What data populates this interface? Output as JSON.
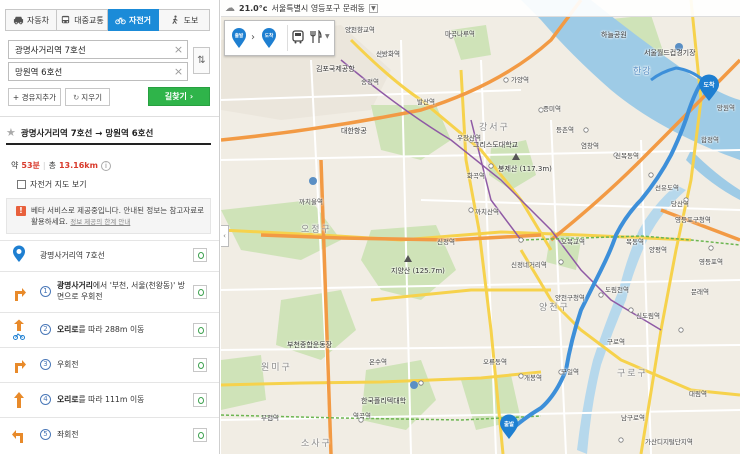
{
  "tabs": [
    {
      "label": "자동차",
      "icon": "car-icon",
      "active": false
    },
    {
      "label": "대중교통",
      "icon": "bus-icon",
      "active": false
    },
    {
      "label": "자전거",
      "icon": "bicycle-icon",
      "active": true
    },
    {
      "label": "도보",
      "icon": "walk-icon",
      "active": false
    }
  ],
  "search": {
    "origin_value": "광명사거리역 7호선",
    "destination_value": "망원역 6호선"
  },
  "actions": {
    "add_waypoint": "+ 경유지추가",
    "clear": "지우기",
    "find_route": "길찾기"
  },
  "route": {
    "title": "광명사거리역 7호선 → 망원역 6호선",
    "time_prefix": "약",
    "time": "53분",
    "distance_prefix": "총",
    "distance": "13.16km",
    "bike_map_label": "자전거 지도 보기",
    "beta_notice": "베타 서비스로 제공중입니다. 안내된 정보는 참고자료로 활용하세요.",
    "beta_link": "정보 제공의 한계 안내",
    "start_label": "광명사거리역 7호선"
  },
  "steps": [
    {
      "num": "1",
      "bold": "광명사거리",
      "text": "에서 '부천, 서울(천왕동)' 방면으로 우회전",
      "icon": "turn-right-icon"
    },
    {
      "num": "2",
      "bold": "오리로",
      "text": "를 따라 288m 이동",
      "icon": "straight-bike-icon"
    },
    {
      "num": "3",
      "bold": "",
      "text": "우회전",
      "icon": "turn-right-icon"
    },
    {
      "num": "4",
      "bold": "오리로",
      "text": "를 따라 111m 이동",
      "icon": "straight-icon"
    },
    {
      "num": "5",
      "bold": "",
      "text": "좌회전",
      "icon": "turn-left-icon"
    }
  ],
  "map": {
    "weather_temp": "21.0°c",
    "weather_location": "서울특별시 영등포구 문래동",
    "start_marker": "출발",
    "end_marker": "도착",
    "colors": {
      "route": "#3d8fd9",
      "river": "#9ecbe6",
      "park": "#cfe3b8",
      "highway": "#f29a44"
    },
    "labels": {
      "river_name": "한강",
      "districts": [
        "강서구",
        "양천구",
        "구로구",
        "원미구",
        "소사구",
        "오정구"
      ],
      "mountains": [
        "봉제산 (117.3m)",
        "지양산 (125.7m)"
      ],
      "places": [
        "그리스도대학교",
        "대한항공",
        "김포국제공항",
        "부천종합운동장",
        "한국폴리텍대학",
        "서울월드컵경기장",
        "하늘공원"
      ],
      "stations": [
        "양천향교역",
        "신방화역",
        "마곡나루역",
        "송정역",
        "가양역",
        "증미역",
        "등촌역",
        "염창역",
        "신목동역",
        "선유도역",
        "당산역",
        "영등포구청역",
        "목동역",
        "오목교역",
        "양평역",
        "까치산역",
        "신정네거리역",
        "양천구청역",
        "도림천역",
        "신도림역",
        "구로역",
        "구일역",
        "개봉역",
        "오류동역",
        "온수역",
        "역곡역",
        "부천역",
        "까치울역",
        "망원역",
        "합정역",
        "화곡역",
        "우장산역",
        "발산역",
        "신정역",
        "목동",
        "영등포역",
        "문래역",
        "대림역",
        "남구로역",
        "가산디지털단지역"
      ]
    }
  }
}
